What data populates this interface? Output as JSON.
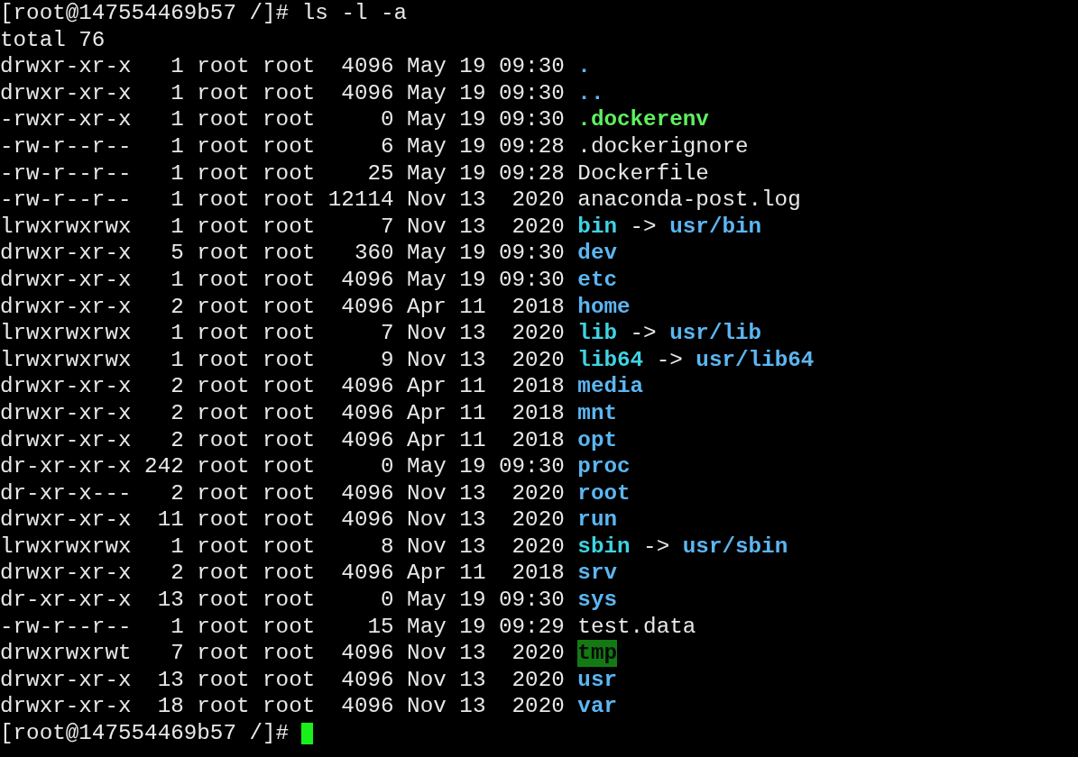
{
  "prompt": "[root@147554469b57 /]#",
  "command": "ls -l -a",
  "total": "total 76",
  "entries": [
    {
      "details": "drwxr-xr-x   1 root root  4096 May 19 09:30",
      "name": ".",
      "kind": "dir"
    },
    {
      "details": "drwxr-xr-x   1 root root  4096 May 19 09:30",
      "name": "..",
      "kind": "dir"
    },
    {
      "details": "-rwxr-xr-x   1 root root     0 May 19 09:30",
      "name": ".dockerenv",
      "kind": "exec"
    },
    {
      "details": "-rw-r--r--   1 root root     6 May 19 09:28",
      "name": ".dockerignore",
      "kind": "file"
    },
    {
      "details": "-rw-r--r--   1 root root    25 May 19 09:28",
      "name": "Dockerfile",
      "kind": "file"
    },
    {
      "details": "-rw-r--r--   1 root root 12114 Nov 13  2020",
      "name": "anaconda-post.log",
      "kind": "file"
    },
    {
      "details": "lrwxrwxrwx   1 root root     7 Nov 13  2020",
      "name": "bin",
      "kind": "link",
      "arrow": "->",
      "target": "usr/bin"
    },
    {
      "details": "drwxr-xr-x   5 root root   360 May 19 09:30",
      "name": "dev",
      "kind": "dir"
    },
    {
      "details": "drwxr-xr-x   1 root root  4096 May 19 09:30",
      "name": "etc",
      "kind": "dir"
    },
    {
      "details": "drwxr-xr-x   2 root root  4096 Apr 11  2018",
      "name": "home",
      "kind": "dir"
    },
    {
      "details": "lrwxrwxrwx   1 root root     7 Nov 13  2020",
      "name": "lib",
      "kind": "link",
      "arrow": "->",
      "target": "usr/lib"
    },
    {
      "details": "lrwxrwxrwx   1 root root     9 Nov 13  2020",
      "name": "lib64",
      "kind": "link",
      "arrow": "->",
      "target": "usr/lib64"
    },
    {
      "details": "drwxr-xr-x   2 root root  4096 Apr 11  2018",
      "name": "media",
      "kind": "dir"
    },
    {
      "details": "drwxr-xr-x   2 root root  4096 Apr 11  2018",
      "name": "mnt",
      "kind": "dir"
    },
    {
      "details": "drwxr-xr-x   2 root root  4096 Apr 11  2018",
      "name": "opt",
      "kind": "dir"
    },
    {
      "details": "dr-xr-xr-x 242 root root     0 May 19 09:30",
      "name": "proc",
      "kind": "dir"
    },
    {
      "details": "dr-xr-x---   2 root root  4096 Nov 13  2020",
      "name": "root",
      "kind": "dir"
    },
    {
      "details": "drwxr-xr-x  11 root root  4096 Nov 13  2020",
      "name": "run",
      "kind": "dir"
    },
    {
      "details": "lrwxrwxrwx   1 root root     8 Nov 13  2020",
      "name": "sbin",
      "kind": "link",
      "arrow": "->",
      "target": "usr/sbin"
    },
    {
      "details": "drwxr-xr-x   2 root root  4096 Apr 11  2018",
      "name": "srv",
      "kind": "dir"
    },
    {
      "details": "dr-xr-xr-x  13 root root     0 May 19 09:30",
      "name": "sys",
      "kind": "dir"
    },
    {
      "details": "-rw-r--r--   1 root root    15 May 19 09:29",
      "name": "test.data",
      "kind": "file"
    },
    {
      "details": "drwxrwxrwt   7 root root  4096 Nov 13  2020",
      "name": "tmp",
      "kind": "sticky"
    },
    {
      "details": "drwxr-xr-x  13 root root  4096 Nov 13  2020",
      "name": "usr",
      "kind": "dir"
    },
    {
      "details": "drwxr-xr-x  18 root root  4096 Nov 13  2020",
      "name": "var",
      "kind": "dir"
    }
  ],
  "next_prompt": "[root@147554469b57 /]#"
}
